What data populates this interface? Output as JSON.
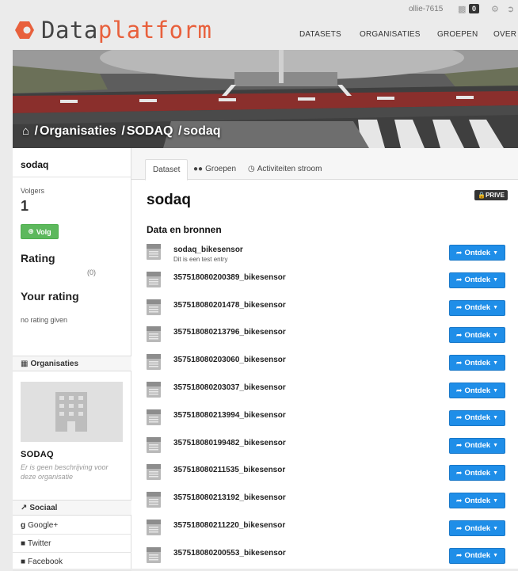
{
  "topbar": {
    "username": "ollie-7615",
    "notification_count": "0",
    "icons": [
      "dashboard-icon",
      "gear-icon",
      "sign-out-icon"
    ]
  },
  "logo": {
    "part1": "Data",
    "part2": "platform",
    "color_part1": "#444444",
    "color_part2": "#e8603c"
  },
  "nav": {
    "items": [
      "DATASETS",
      "ORGANISATIES",
      "GROEPEN",
      "OVER"
    ]
  },
  "breadcrumb": {
    "home_icon": "home-icon",
    "items": [
      "Organisaties",
      "SODAQ",
      "sodaq"
    ],
    "separator": "/"
  },
  "sidebar": {
    "title": "sodaq",
    "followers_label": "Volgers",
    "followers_count": "1",
    "follow_button": "Volg",
    "rating_heading": "Rating",
    "rating_count": "(0)",
    "your_rating_heading": "Your rating",
    "no_rating_text": "no rating given",
    "organisations_heading": "Organisaties",
    "org_name": "SODAQ",
    "org_description": "Er is geen beschrijving voor deze organisatie",
    "social_heading": "Sociaal",
    "social_items": [
      "Google+",
      "Twitter",
      "Facebook"
    ]
  },
  "tabs": [
    "Dataset",
    "Groepen",
    "Activiteiten stroom"
  ],
  "main": {
    "title": "sodaq",
    "private_badge": "PRIVE",
    "section_heading": "Data en bronnen",
    "explore_label": "Ontdek",
    "datasets": [
      {
        "name": "sodaq_bikesensor",
        "description": "Dit is een test entry"
      },
      {
        "name": "357518080200389_bikesensor",
        "description": ""
      },
      {
        "name": "357518080201478_bikesensor",
        "description": ""
      },
      {
        "name": "357518080213796_bikesensor",
        "description": ""
      },
      {
        "name": "357518080203060_bikesensor",
        "description": ""
      },
      {
        "name": "357518080203037_bikesensor",
        "description": ""
      },
      {
        "name": "357518080213994_bikesensor",
        "description": ""
      },
      {
        "name": "357518080199482_bikesensor",
        "description": ""
      },
      {
        "name": "357518080211535_bikesensor",
        "description": ""
      },
      {
        "name": "357518080213192_bikesensor",
        "description": ""
      },
      {
        "name": "357518080211220_bikesensor",
        "description": ""
      },
      {
        "name": "357518080200553_bikesensor",
        "description": ""
      }
    ]
  },
  "colors": {
    "accent": "#e8603c",
    "button_primary": "#1f8ee8",
    "button_success": "#5cb85c",
    "badge_dark": "#333333"
  }
}
